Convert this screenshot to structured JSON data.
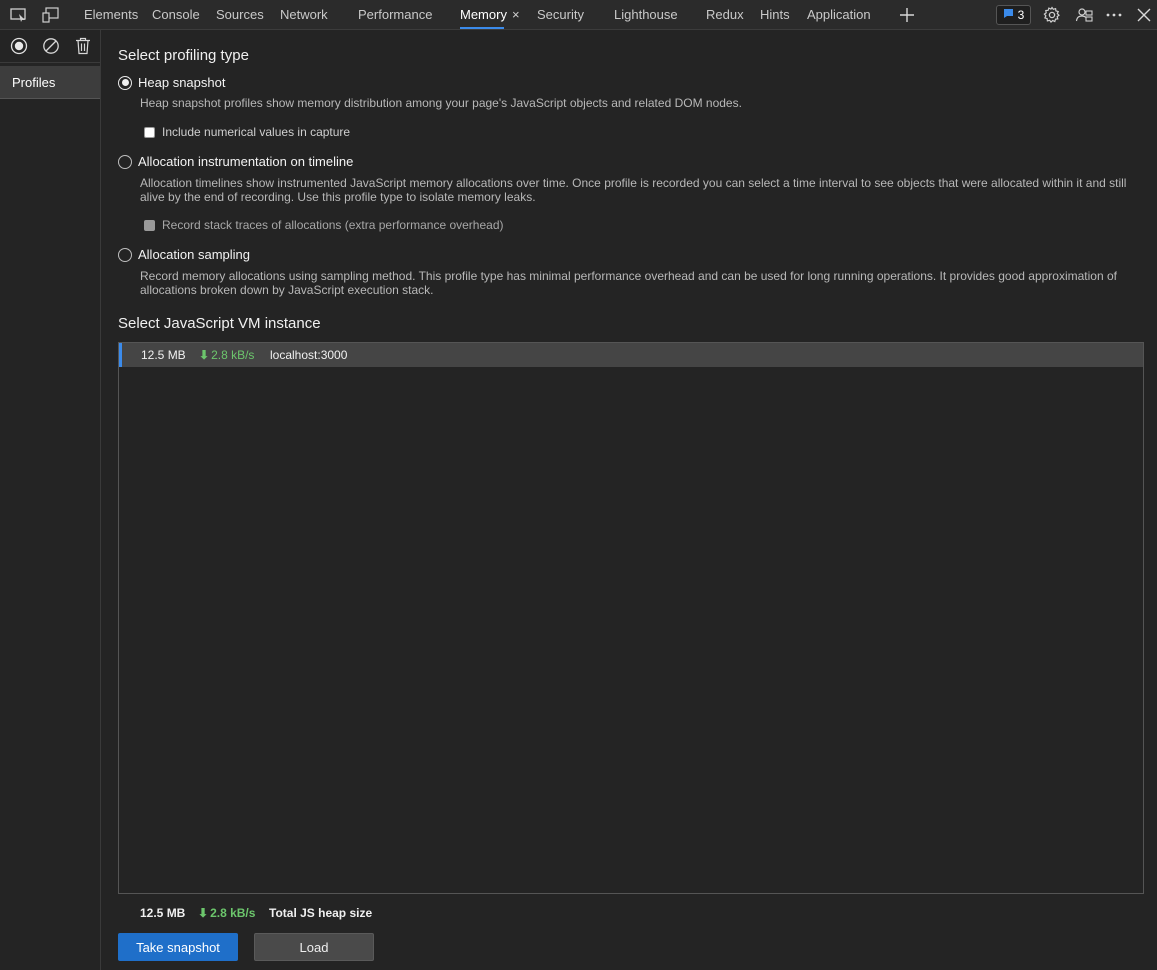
{
  "tabbar": {
    "tabs": [
      {
        "label": "Elements",
        "active": false
      },
      {
        "label": "Console",
        "active": false
      },
      {
        "label": "Sources",
        "active": false
      },
      {
        "label": "Network",
        "active": false
      },
      {
        "label": "Performance",
        "active": false
      },
      {
        "label": "Memory",
        "active": true
      },
      {
        "label": "Security",
        "active": false
      },
      {
        "label": "Lighthouse",
        "active": false
      },
      {
        "label": "Redux",
        "active": false
      },
      {
        "label": "Hints",
        "active": false
      },
      {
        "label": "Application",
        "active": false
      }
    ],
    "close_glyph": "×",
    "issues_count": "3",
    "accent_color": "#3b8beb",
    "icons": [
      "inspect-icon",
      "device-toolbar-icon",
      "add-tab-icon",
      "issues-icon",
      "gear-icon",
      "customize-icon",
      "more-icon",
      "close-icon"
    ]
  },
  "sidebar": {
    "toolbar_icons": [
      "record-icon",
      "clear-icon",
      "trash-icon"
    ],
    "items": [
      {
        "label": "Profiles"
      }
    ]
  },
  "main": {
    "profiling_heading": "Select profiling type",
    "options": [
      {
        "label": "Heap snapshot",
        "checked": true,
        "description": "Heap snapshot profiles show memory distribution among your page's JavaScript objects and related DOM nodes.",
        "checkbox": {
          "label": "Include numerical values in capture",
          "checked": false,
          "disabled": false
        }
      },
      {
        "label": "Allocation instrumentation on timeline",
        "checked": false,
        "description": "Allocation timelines show instrumented JavaScript memory allocations over time. Once profile is recorded you can select a time interval to see objects that were allocated within it and still alive by the end of recording. Use this profile type to isolate memory leaks.",
        "checkbox": {
          "label": "Record stack traces of allocations (extra performance overhead)",
          "checked": false,
          "disabled": true
        }
      },
      {
        "label": "Allocation sampling",
        "checked": false,
        "description": "Record memory allocations using sampling method. This profile type has minimal performance overhead and can be used for long running operations. It provides good approximation of allocations broken down by JavaScript execution stack."
      }
    ],
    "vm_heading": "Select JavaScript VM instance",
    "vm_instances": [
      {
        "size": "12.5 MB",
        "rate": "2.8 kB/s",
        "name": "localhost:3000",
        "selected": true
      }
    ],
    "footer": {
      "size": "12.5 MB",
      "rate": "2.8 kB/s",
      "label": "Total JS heap size"
    },
    "buttons": {
      "take_snapshot": "Take snapshot",
      "load": "Load"
    },
    "rate_color": "#6cc66c",
    "primary_button_color": "#1f6fc9"
  }
}
